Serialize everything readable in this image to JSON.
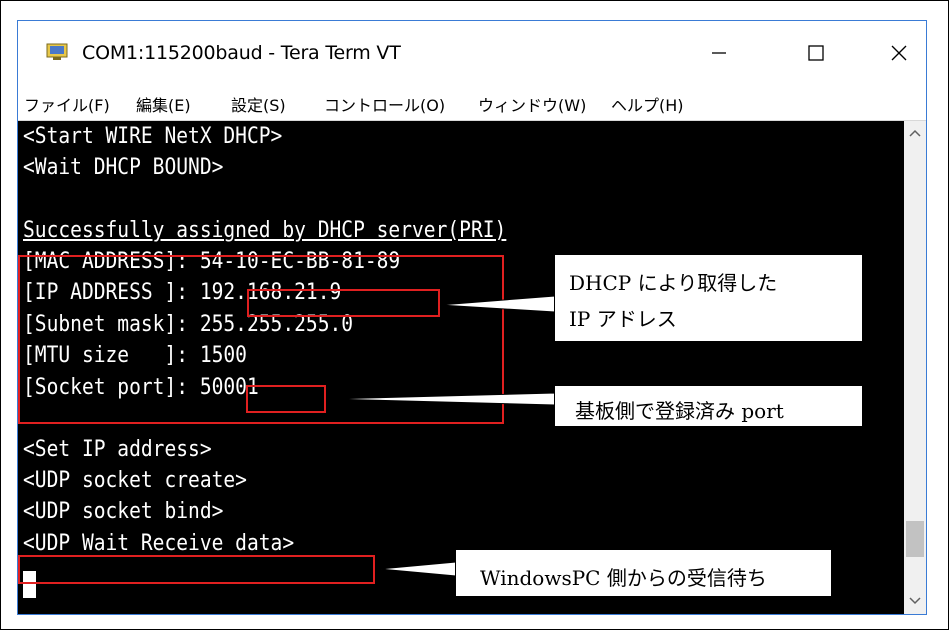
{
  "window": {
    "title": "COM1:115200baud - Tera Term VT",
    "controls": {
      "minimize": "—",
      "maximize": "☐",
      "close": "✕"
    }
  },
  "menu": [
    "ファイル(F)",
    "編集(E)",
    "設定(S)",
    "コントロール(O)",
    "ウィンドウ(W)",
    "ヘルプ(H)"
  ],
  "terminal": {
    "lines": [
      "<Start WIRE NetX DHCP>",
      "<Wait DHCP BOUND>",
      "",
      "Successfully assigned by DHCP server(PRI)",
      "[MAC ADDRESS]: 54-10-EC-BB-81-89",
      "[IP ADDRESS ]: 192.168.21.9",
      "[Subnet mask]: 255.255.255.0",
      "[MTU size   ]: 1500",
      "[Socket port]: 50001",
      "",
      "<Set IP address>",
      "<UDP socket create>",
      "<UDP socket bind>",
      "<UDP Wait Receive data>"
    ]
  },
  "callouts": {
    "dhcp_line1": "DHCP により取得した",
    "dhcp_line2": "IP アドレス",
    "port": "基板側で登録済み port",
    "wait": "WindowsPC 側からの受信待ち"
  },
  "colors": {
    "highlight": "#e02020",
    "terminal_bg": "#000000",
    "terminal_fg": "#ffffff"
  }
}
